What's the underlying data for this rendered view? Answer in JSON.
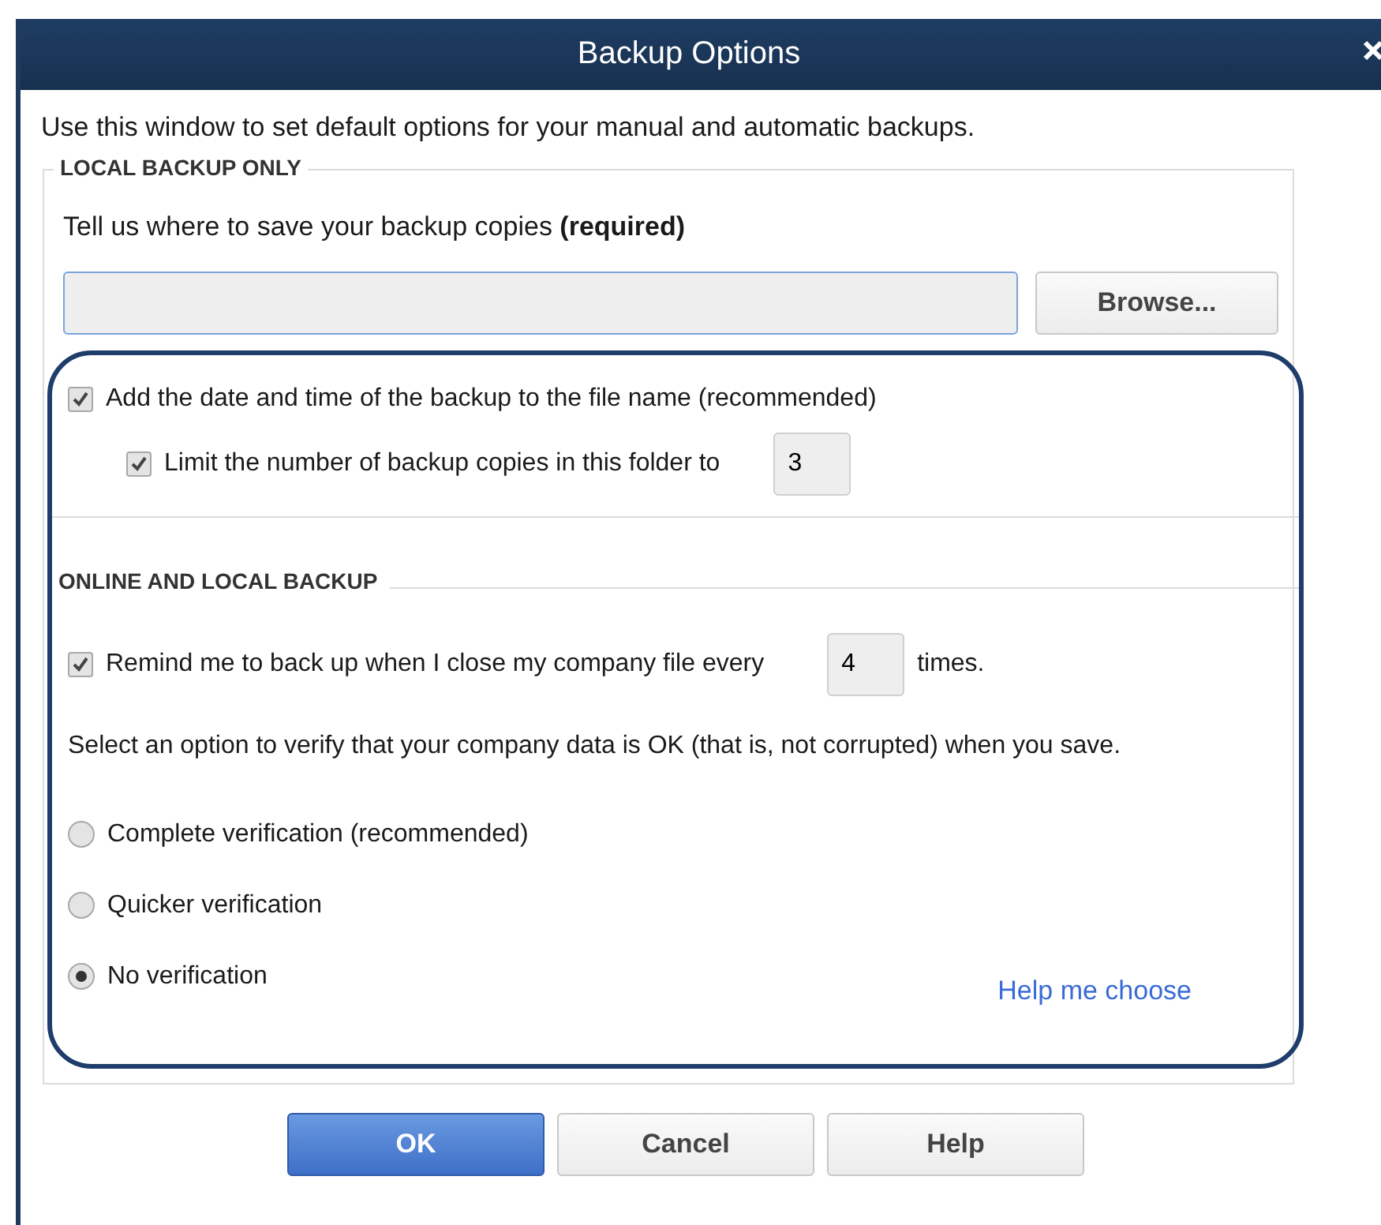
{
  "window": {
    "title": "Backup Options"
  },
  "intro": "Use this window to set default options for your manual and automatic backups.",
  "local_backup": {
    "heading": "LOCAL BACKUP ONLY",
    "prompt": "Tell us where to save your backup copies **(required)**",
    "browse_button": "Browse...",
    "options": [
      {
        "label": "Add the date and time of the backup to the file name (recommended)",
        "checked": true,
        "children": [
          {
            "label": "Limit the number of backup copies in this folder to",
            "checked": true,
            "value": "3"
          }
        ]
      }
    ]
  },
  "online_backup": {
    "heading": "ONLINE AND LOCAL BACKUP",
    "remind": {
      "label": "Remind me to back up when I close my company file every",
      "checked": true,
      "value": "4",
      "suffix": "times."
    },
    "verify_prompt": "Select an option to verify that your company data is OK (that is, not corrupted) when you save.",
    "verification": [
      {
        "label": "Complete verification (recommended)",
        "selected": false
      },
      {
        "label": "Quicker verification",
        "selected": false
      },
      {
        "label": "No verification",
        "selected": true
      }
    ],
    "help_link": "Help me choose"
  },
  "buttons": [
    {
      "label": "OK",
      "primary": true
    },
    {
      "label": "Cancel",
      "primary": false
    },
    {
      "label": "Help",
      "primary": false
    }
  ]
}
